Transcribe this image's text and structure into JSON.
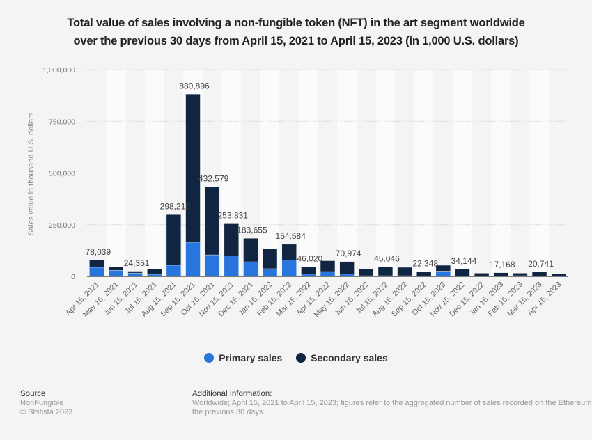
{
  "title_line1": "Total value of sales involving a non-fungible token (NFT) in the art segment worldwide",
  "title_line2": "over the previous 30 days from April 15, 2021 to April 15, 2023 (in 1,000 U.S. dollars)",
  "colors": {
    "primary": "#2876dd",
    "secondary": "#0f2541",
    "axis_text": "#777",
    "label_text": "#444"
  },
  "chart_data": {
    "type": "bar",
    "stacked": true,
    "title": "Total value of sales involving a non-fungible token (NFT) in the art segment worldwide over the previous 30 days from April 15, 2021 to April 15, 2023 (in 1,000 U.S. dollars)",
    "xlabel": "",
    "ylabel": "Sales value in thousand U.S. dollars",
    "ylim": [
      0,
      1000000
    ],
    "yticks": [
      0,
      250000,
      500000,
      750000,
      1000000
    ],
    "ytick_labels": [
      "0",
      "250,000",
      "500,000",
      "750,000",
      "1,000,000"
    ],
    "grid": true,
    "legend_position": "bottom",
    "categories": [
      "Apr 15, 2021",
      "May 15, 2021",
      "Jun 15, 2021",
      "Jul 15, 2021",
      "Aug 15, 2021",
      "Sep 15, 2021",
      "Oct 15, 2021",
      "Nov 15, 2021",
      "Dec 15, 2021",
      "Jan 15, 2022",
      "Feb 15, 2022",
      "Mar 15, 2022",
      "Apr 15, 2022",
      "May 15, 2022",
      "Jun 15, 2022",
      "Jul 15, 2022",
      "Aug 15, 2022",
      "Sep 15, 2022",
      "Oct 15, 2022",
      "Nov 15, 2022",
      "Dec 15, 2022",
      "Jan 15, 2023",
      "Feb 15, 2023",
      "Mar 15, 2023",
      "Apr 15, 2023"
    ],
    "series": [
      {
        "name": "Primary sales",
        "color": "#2876dd",
        "values": [
          44000,
          29000,
          16000,
          10000,
          54000,
          165000,
          104000,
          99000,
          70000,
          37000,
          79000,
          11000,
          23000,
          11000,
          3000,
          3000,
          3000,
          2000,
          25000,
          1000,
          1000,
          1000,
          3000,
          1000,
          1000
        ]
      },
      {
        "name": "Secondary sales",
        "color": "#0f2541",
        "values": [
          34039,
          15000,
          8351,
          25000,
          244210,
          715896,
          328579,
          154831,
          113655,
          96000,
          75584,
          35020,
          52000,
          59974,
          33000,
          42046,
          40000,
          20348,
          28000,
          33144,
          14000,
          16168,
          12000,
          19741,
          10000
        ]
      }
    ],
    "totals": [
      78039,
      44000,
      24351,
      35000,
      298210,
      880896,
      432579,
      253831,
      183655,
      133000,
      154584,
      46020,
      75000,
      70974,
      36000,
      45046,
      43000,
      22348,
      53000,
      34144,
      15000,
      17168,
      15000,
      20741,
      11000
    ],
    "data_labels": [
      "78,039",
      "",
      "24,351",
      "",
      "298,210",
      "880,896",
      "432,579",
      "253,831",
      "183,655",
      "",
      "154,584",
      "46,020",
      "",
      "70,974",
      "",
      "45,046",
      "",
      "22,348",
      "",
      "34,144",
      "",
      "17,168",
      "",
      "20,741",
      ""
    ]
  },
  "legend": {
    "primary_label": "Primary sales",
    "secondary_label": "Secondary sales"
  },
  "footer": {
    "source_heading": "Source",
    "source_name": "NonFungible",
    "copyright": "© Statista 2023",
    "info_heading": "Additional Information:",
    "info_line1": "Worldwide; April 15, 2021 to April 15, 2023; figures refer to the aggregated number of sales recorded on the Ethereum, Ronin, Flow, WAX and BSC blockchains over",
    "info_line2": "the previous 30 days"
  }
}
